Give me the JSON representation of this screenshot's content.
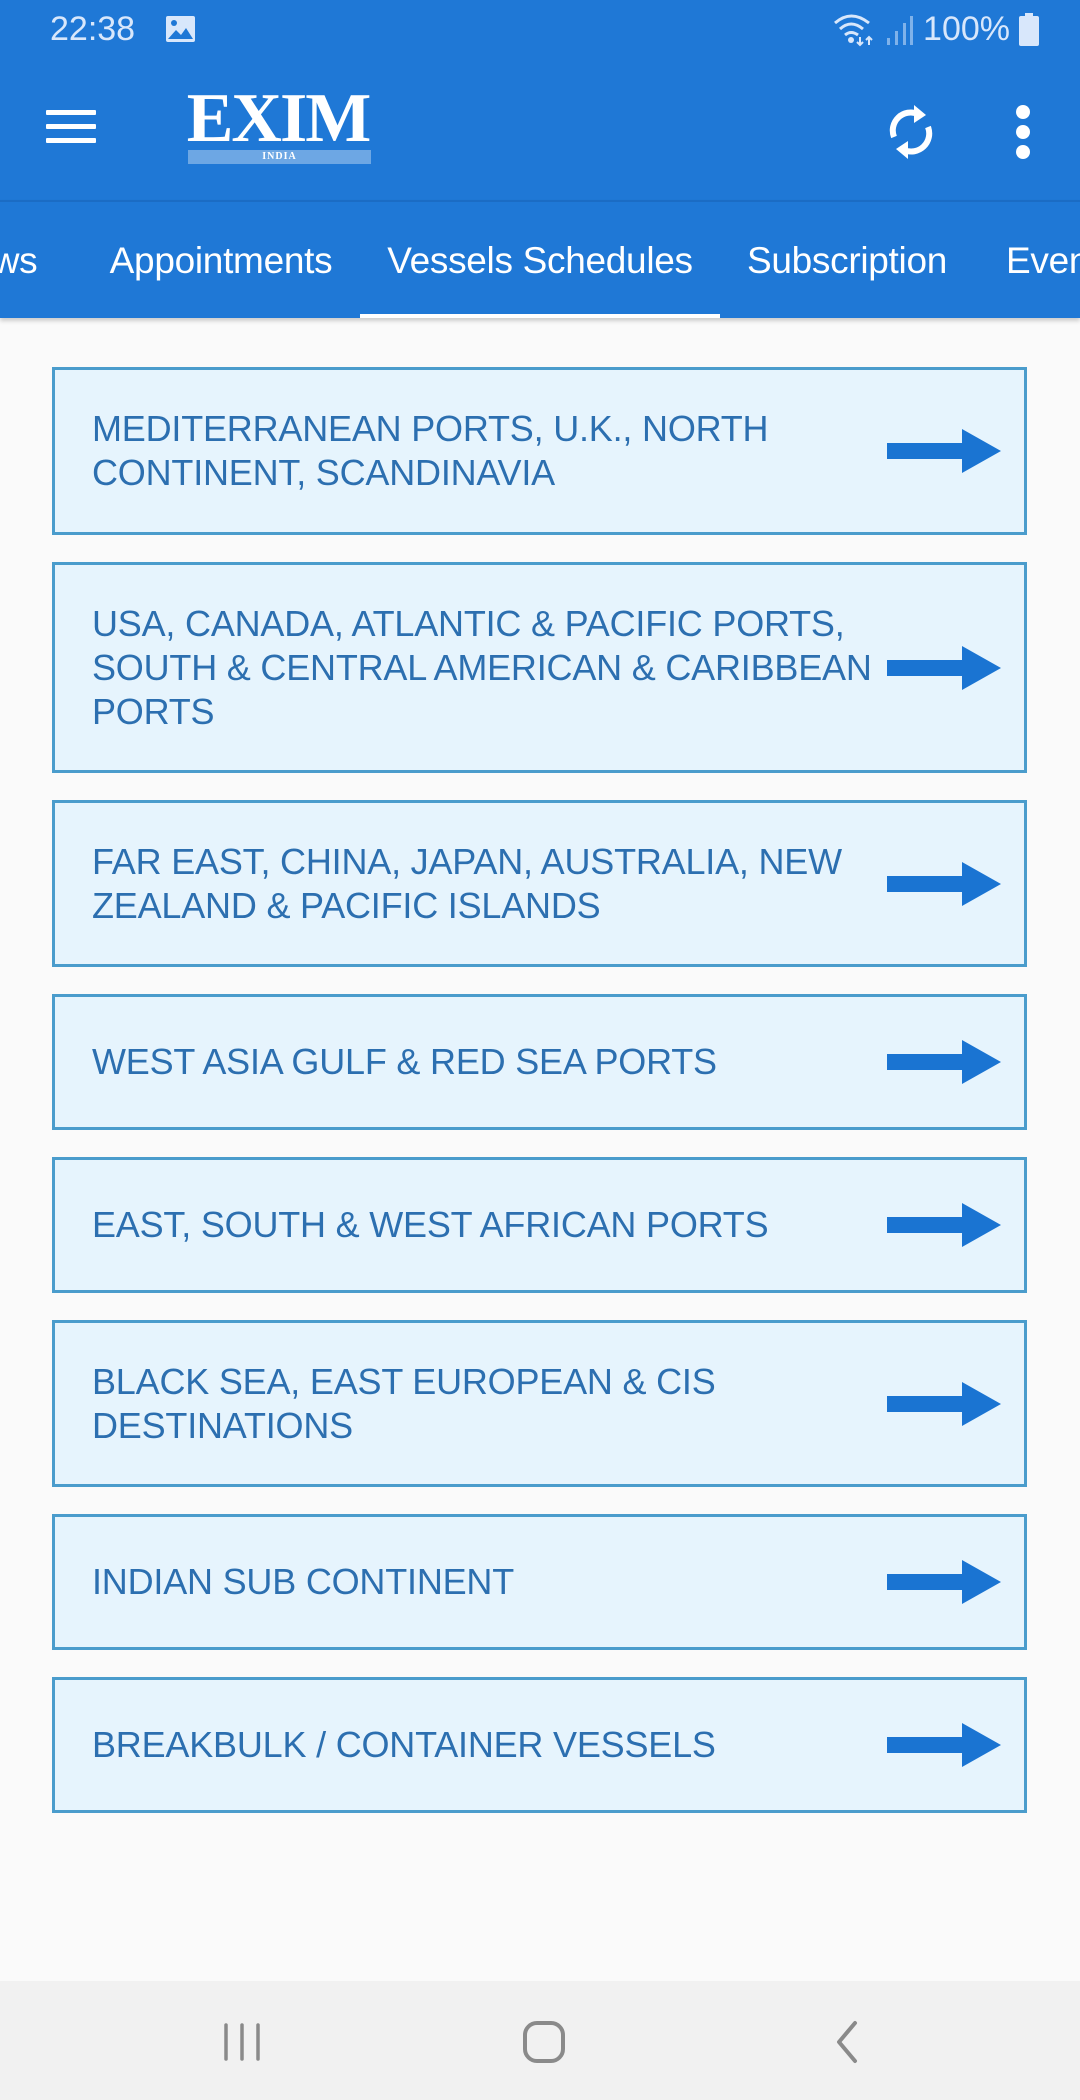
{
  "status_bar": {
    "time": "22:38",
    "notification_icon": "image-icon",
    "wifi_icon": "wifi-icon",
    "signal_icon": "signal-icon",
    "battery_percent": "100%",
    "battery_icon": "battery-icon"
  },
  "app_bar": {
    "menu_icon": "hamburger-menu-icon",
    "logo_text": "EXIM",
    "logo_subtext": "INDIA",
    "refresh_icon": "refresh-icon",
    "more_icon": "more-vert-icon"
  },
  "tabs": [
    {
      "label": "ws",
      "full_label": "News",
      "active": false
    },
    {
      "label": "Appointments",
      "active": false
    },
    {
      "label": "Vessels Schedules",
      "active": true
    },
    {
      "label": "Subscription",
      "active": false
    },
    {
      "label": "Even",
      "full_label": "Events",
      "active": false
    }
  ],
  "regions": [
    {
      "label": "MEDITERRANEAN PORTS, U.K., NORTH CONTINENT, SCANDINAVIA",
      "icon": "arrow-right-icon"
    },
    {
      "label": "USA, CANADA, ATLANTIC & PACIFIC PORTS, SOUTH & CENTRAL AMERICAN & CARIBBEAN PORTS",
      "icon": "arrow-right-icon"
    },
    {
      "label": "FAR EAST, CHINA, JAPAN, AUSTRALIA, NEW ZEALAND & PACIFIC ISLANDS",
      "icon": "arrow-right-icon"
    },
    {
      "label": "WEST ASIA GULF & RED SEA PORTS",
      "icon": "arrow-right-icon"
    },
    {
      "label": "EAST, SOUTH & WEST AFRICAN PORTS",
      "icon": "arrow-right-icon"
    },
    {
      "label": "BLACK SEA, EAST EUROPEAN & CIS DESTINATIONS",
      "icon": "arrow-right-icon"
    },
    {
      "label": "INDIAN SUB CONTINENT",
      "icon": "arrow-right-icon"
    },
    {
      "label": "BREAKBULK / CONTAINER VESSELS",
      "icon": "arrow-right-icon"
    }
  ],
  "nav_bar": {
    "recents_icon": "recents-icon",
    "home_icon": "home-icon",
    "back_icon": "back-icon"
  },
  "colors": {
    "primary": "#1f78d6",
    "card_bg": "#e6f4fd",
    "card_border": "#4a9ccc",
    "card_text": "#2c6fb0",
    "arrow": "#1a74d2"
  }
}
